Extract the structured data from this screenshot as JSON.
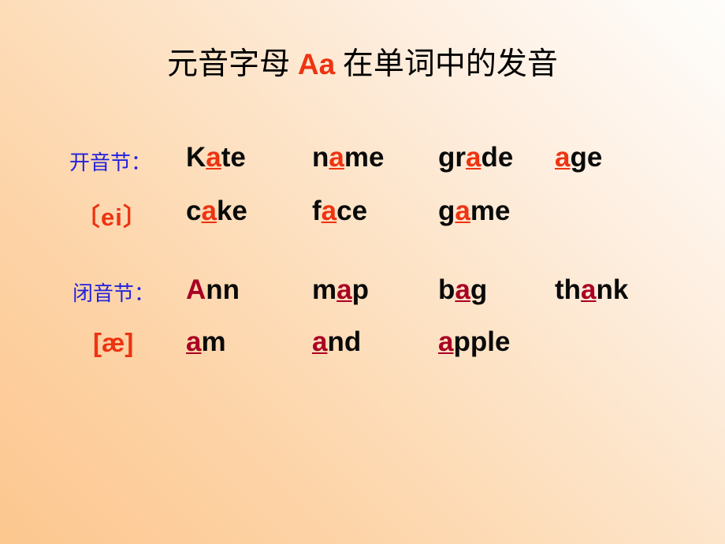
{
  "slide": {
    "background_start": "#fcc78f",
    "background_end": "#fffdfb",
    "title": {
      "before": "元音字母 ",
      "highlight": "Aa",
      "after": " 在单词中的发音"
    }
  },
  "colors": {
    "label_blue": "#2222dd",
    "open_red": "#ee3311",
    "closed_crimson": "#a80023",
    "word_black": "#0a0a0a"
  },
  "sections": [
    {
      "id": "open-syllable",
      "label": "开音节：",
      "phonetic": "〔ei〕",
      "rows": [
        [
          {
            "pre": "K",
            "mid": "a",
            "post": "te"
          },
          {
            "pre": "n",
            "mid": "a",
            "post": "me"
          },
          {
            "pre": "gr",
            "mid": "a",
            "post": "de"
          },
          {
            "pre": "",
            "mid": "a",
            "post": "ge"
          }
        ],
        [
          {
            "pre": "c",
            "mid": "a",
            "post": "ke"
          },
          {
            "pre": "f",
            "mid": "a",
            "post": "ce"
          },
          {
            "pre": "g",
            "mid": "a",
            "post": "me"
          }
        ]
      ]
    },
    {
      "id": "closed-syllable",
      "label": "闭音节：",
      "phonetic": "[æ]",
      "rows": [
        [
          {
            "pre": "",
            "mid": "A",
            "post": "nn",
            "plain": true
          },
          {
            "pre": "m",
            "mid": "a",
            "post": "p"
          },
          {
            "pre": "b",
            "mid": "a",
            "post": "g"
          },
          {
            "pre": "th",
            "mid": "a",
            "post": "nk"
          }
        ],
        [
          {
            "pre": "",
            "mid": "a",
            "post": "m"
          },
          {
            "pre": "",
            "mid": "a",
            "post": "nd"
          },
          {
            "pre": "",
            "mid": "a",
            "post": "pple"
          }
        ]
      ]
    }
  ]
}
